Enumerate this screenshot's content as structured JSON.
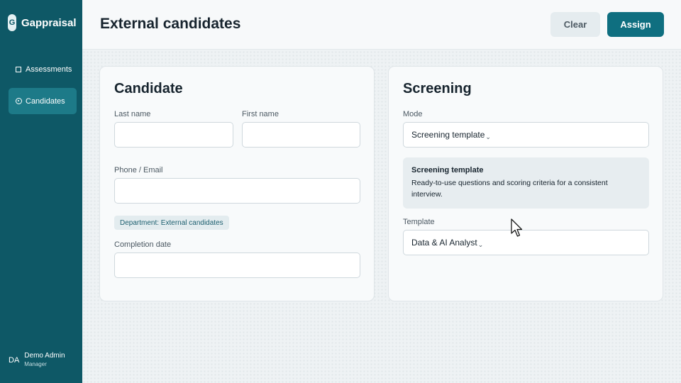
{
  "brand": {
    "logo_letter": "G",
    "name": "Gappraisal"
  },
  "sidebar": {
    "items": [
      {
        "label": "Assessments",
        "icon": "clipboard-icon",
        "active": false
      },
      {
        "label": "Candidates",
        "icon": "target-icon",
        "active": true
      }
    ],
    "user": {
      "initials": "DA",
      "name": "Demo Admin",
      "role": "Manager"
    }
  },
  "header": {
    "title": "External candidates",
    "clear_label": "Clear",
    "assign_label": "Assign"
  },
  "candidate": {
    "title": "Candidate",
    "last_name_label": "Last name",
    "last_name_value": "",
    "first_name_label": "First name",
    "first_name_value": "",
    "contact_label": "Phone / Email",
    "contact_value": "",
    "department_chip": "Department: External candidates",
    "completion_label": "Completion date",
    "completion_value": ""
  },
  "screening": {
    "title": "Screening",
    "mode_label": "Mode",
    "mode_value": "Screening template",
    "info_title": "Screening template",
    "info_text": "Ready-to-use questions and scoring criteria for a consistent interview.",
    "template_label": "Template",
    "template_value": "Data & AI Analyst"
  },
  "colors": {
    "sidebar": "#0e5866",
    "accent": "#0f6f80",
    "active_nav": "#1d7a88"
  }
}
